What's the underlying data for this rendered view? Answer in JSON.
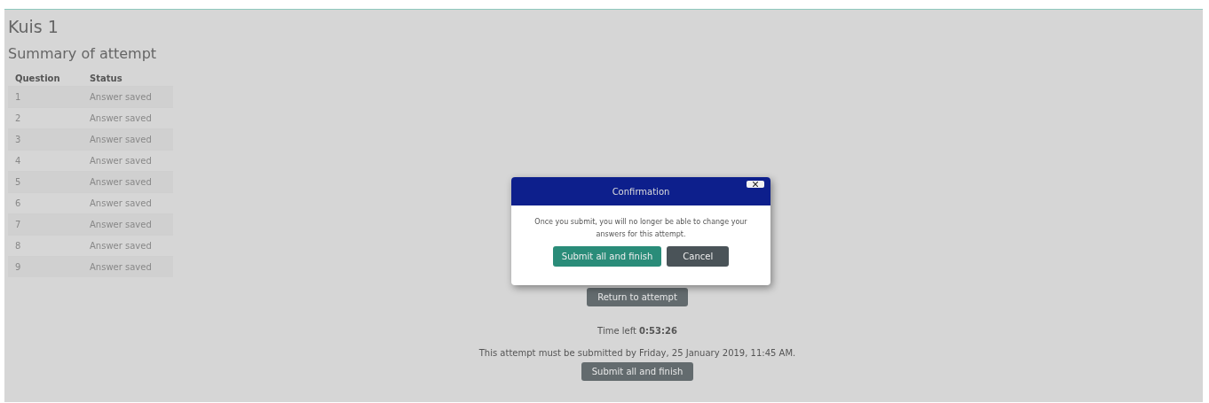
{
  "page": {
    "title": "Kuis 1",
    "subtitle": "Summary of attempt"
  },
  "table": {
    "columns": [
      "Question",
      "Status"
    ],
    "rows": [
      {
        "question": "1",
        "status": "Answer saved"
      },
      {
        "question": "2",
        "status": "Answer saved"
      },
      {
        "question": "3",
        "status": "Answer saved"
      },
      {
        "question": "4",
        "status": "Answer saved"
      },
      {
        "question": "5",
        "status": "Answer saved"
      },
      {
        "question": "6",
        "status": "Answer saved"
      },
      {
        "question": "7",
        "status": "Answer saved"
      },
      {
        "question": "8",
        "status": "Answer saved"
      },
      {
        "question": "9",
        "status": "Answer saved"
      }
    ]
  },
  "return_button": "Return to attempt",
  "time_left": "Time left **0:53:26**",
  "deadline": "This attempt must be submitted by Friday, 25 January 2019, 11:45 AM.",
  "submit_button": "Submit all and finish",
  "dialog": {
    "title": "Confirmation",
    "message": "Once you submit, you will no longer be able to change your answers for this attempt.",
    "buttons": [
      {
        "label": "Submit all and finish",
        "kind": "primary"
      },
      {
        "label": "Cancel",
        "kind": "secondary"
      }
    ]
  }
}
